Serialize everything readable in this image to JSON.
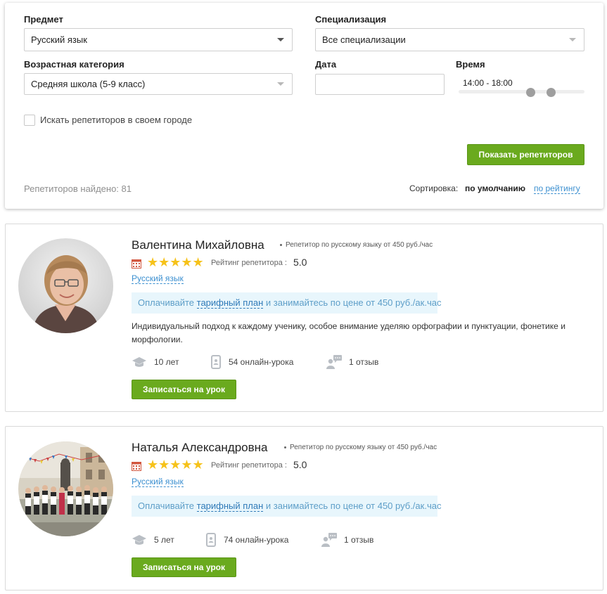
{
  "filters": {
    "subject": {
      "label": "Предмет",
      "value": "Русский язык"
    },
    "specialization": {
      "label": "Специализация",
      "value": "Все специализации"
    },
    "age_category": {
      "label": "Возрастная категория",
      "value": "Средняя школа (5-9 класс)"
    },
    "date": {
      "label": "Дата",
      "value": ""
    },
    "time": {
      "label": "Время",
      "value": "14:00 - 18:00"
    },
    "city_checkbox": {
      "label": "Искать репетиторов в своем городе",
      "checked": false
    },
    "show_button": "Показать репетиторов",
    "found_label": "Репетиторов найдено:",
    "found_count": "81",
    "sort_label": "Сортировка:",
    "sort_default": "по умолчанию",
    "sort_rating": "по рейтингу"
  },
  "tutors": [
    {
      "name": "Валентина Михайловна",
      "description": "Репетитор по русскому языку от 450 руб./час",
      "rating_label": "Рейтинг репетитора :",
      "rating": "5.0",
      "stars": "★★★★★",
      "subject": "Русский язык",
      "promo_pre": "Оплачивайте",
      "promo_link": "тарифный план",
      "promo_post": "и занимайтесь по цене от 450 руб./ак.час",
      "about": "Индивидуальный подход к каждому ученику, особое внимание уделяю орфографии и пунктуации, фонетике и морфологии.",
      "experience": "10 лет",
      "lessons": "54 онлайн-урока",
      "reviews": "1 отзыв",
      "book_button": "Записаться на урок"
    },
    {
      "name": "Наталья Александровна",
      "description": "Репетитор по русскому языку от 450 руб./час",
      "rating_label": "Рейтинг репетитора :",
      "rating": "5.0",
      "stars": "★★★★★",
      "subject": "Русский язык",
      "promo_pre": "Оплачивайте",
      "promo_link": "тарифный план",
      "promo_post": "и занимайтесь по цене от 450 руб./ак.час",
      "experience": "5 лет",
      "lessons": "74 онлайн-урока",
      "reviews": "1 отзыв",
      "book_button": "Записаться на урок"
    }
  ],
  "colors": {
    "accent_green": "#6aaa1e",
    "link_blue": "#3b8fd0",
    "star_yellow": "#f6c21a",
    "promo_bg": "#e8f6fc"
  }
}
